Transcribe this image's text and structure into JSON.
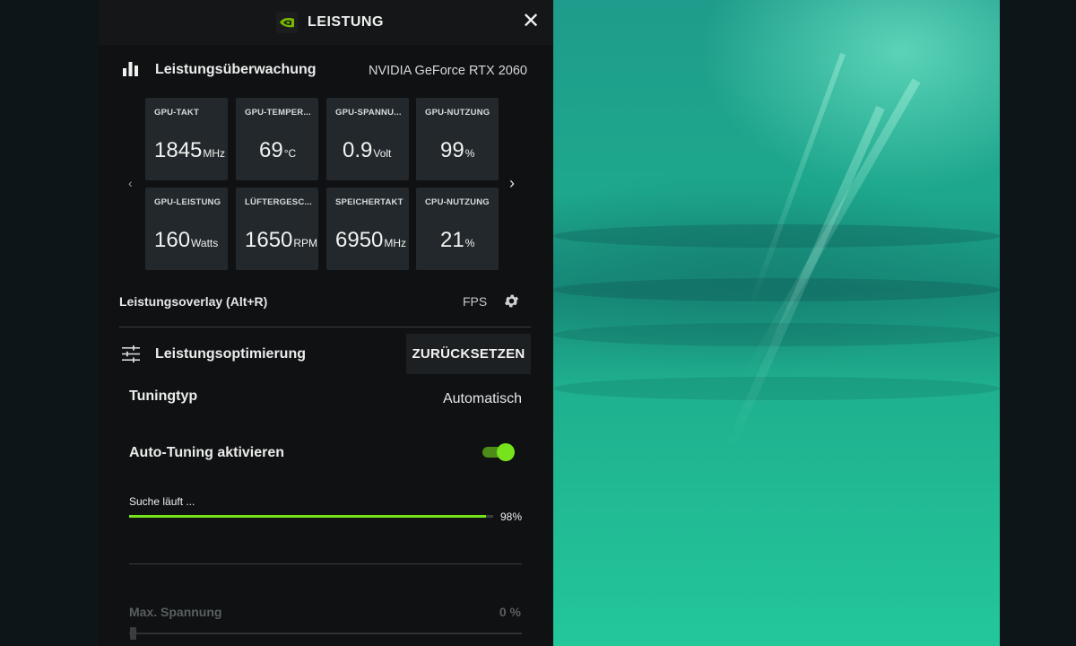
{
  "header": {
    "title": "LEISTUNG",
    "logo_icon": "nvidia-logo",
    "close_icon": "close-icon"
  },
  "monitoring": {
    "title": "Leistungsüberwachung",
    "gpu_name": "NVIDIA GeForce RTX 2060",
    "tiles": [
      {
        "label": "GPU-TAKT",
        "value": "1845",
        "unit": "MHz"
      },
      {
        "label": "GPU-TEMPER...",
        "value": "69",
        "unit": "°C"
      },
      {
        "label": "GPU-SPANNU...",
        "value": "0.9",
        "unit": "Volt"
      },
      {
        "label": "GPU-NUTZUNG",
        "value": "99",
        "unit": "%"
      },
      {
        "label": "GPU-LEISTUNG",
        "value": "160",
        "unit": "Watts"
      },
      {
        "label": "LÜFTERGESC...",
        "value": "1650",
        "unit": "RPM"
      },
      {
        "label": "SPEICHERTAKT",
        "value": "6950",
        "unit": "MHz"
      },
      {
        "label": "CPU-NUTZUNG",
        "value": "21",
        "unit": "%"
      }
    ]
  },
  "overlay": {
    "label": "Leistungsoverlay (Alt+R)",
    "value": "FPS"
  },
  "optimization": {
    "title": "Leistungsoptimierung",
    "reset_label": "ZURÜCKSETZEN",
    "tuning_type_label": "Tuningtyp",
    "tuning_type_value": "Automatisch",
    "auto_tuning_label": "Auto-Tuning aktivieren",
    "auto_tuning_on": true,
    "search_label": "Suche läuft ...",
    "progress_percent": 98,
    "progress_label": "98%",
    "max_voltage_label": "Max. Spannung",
    "max_voltage_value": "0 %"
  },
  "colors": {
    "accent": "#76e31c",
    "panel": "#0f1112",
    "tile": "#22282b"
  }
}
